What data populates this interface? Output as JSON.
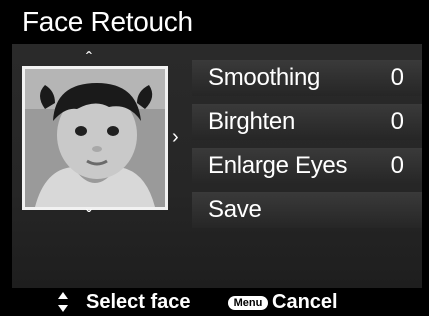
{
  "title": "Face Retouch",
  "menu": {
    "items": [
      {
        "label": "Smoothing",
        "value": "0"
      },
      {
        "label": "Birghten",
        "value": "0"
      },
      {
        "label": "Enlarge Eyes",
        "value": "0"
      },
      {
        "label": "Save",
        "value": ""
      }
    ]
  },
  "icons": {
    "up": "chevron-up-icon",
    "down": "chevron-down-icon",
    "right": "chevron-right-icon",
    "updown": "updown-arrows-icon",
    "menu_key": "menu-button-icon"
  },
  "footer": {
    "select_face": "Select face",
    "menu_key_text": "Menu",
    "cancel": "Cancel"
  }
}
